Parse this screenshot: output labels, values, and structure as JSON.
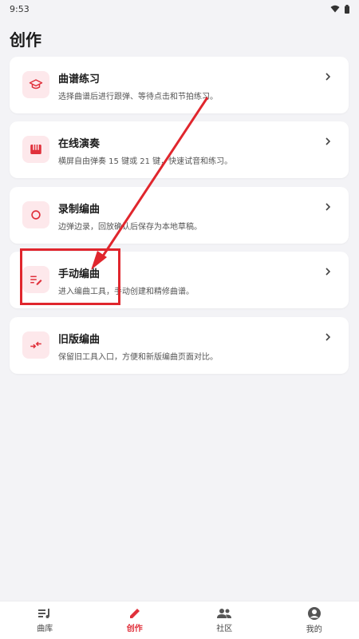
{
  "status": {
    "time": "9:53"
  },
  "page": {
    "title": "创作"
  },
  "cards": [
    {
      "title": "曲谱练习",
      "desc": "选择曲谱后进行跟弹、等待点击和节拍练习。",
      "icon": "graduation-cap-icon"
    },
    {
      "title": "在线演奏",
      "desc": "横屏自由弹奏 15 键或 21 键，快速试音和练习。",
      "icon": "piano-icon"
    },
    {
      "title": "录制编曲",
      "desc": "边弹边录，回放确认后保存为本地草稿。",
      "icon": "record-circle-icon"
    },
    {
      "title": "手动编曲",
      "desc": "进入编曲工具，手动创建和精修曲谱。",
      "icon": "edit-list-icon"
    },
    {
      "title": "旧版编曲",
      "desc": "保留旧工具入口，方便和新版编曲页面对比。",
      "icon": "swap-arrows-icon"
    }
  ],
  "nav": [
    {
      "label": "曲库",
      "icon": "music-library-icon",
      "active": false
    },
    {
      "label": "创作",
      "icon": "pencil-icon",
      "active": true
    },
    {
      "label": "社区",
      "icon": "people-icon",
      "active": false
    },
    {
      "label": "我的",
      "icon": "profile-icon",
      "active": false
    }
  ],
  "colors": {
    "accent": "#e0303b",
    "icon_bg": "#fde8eb",
    "annotation": "#e0262d"
  }
}
